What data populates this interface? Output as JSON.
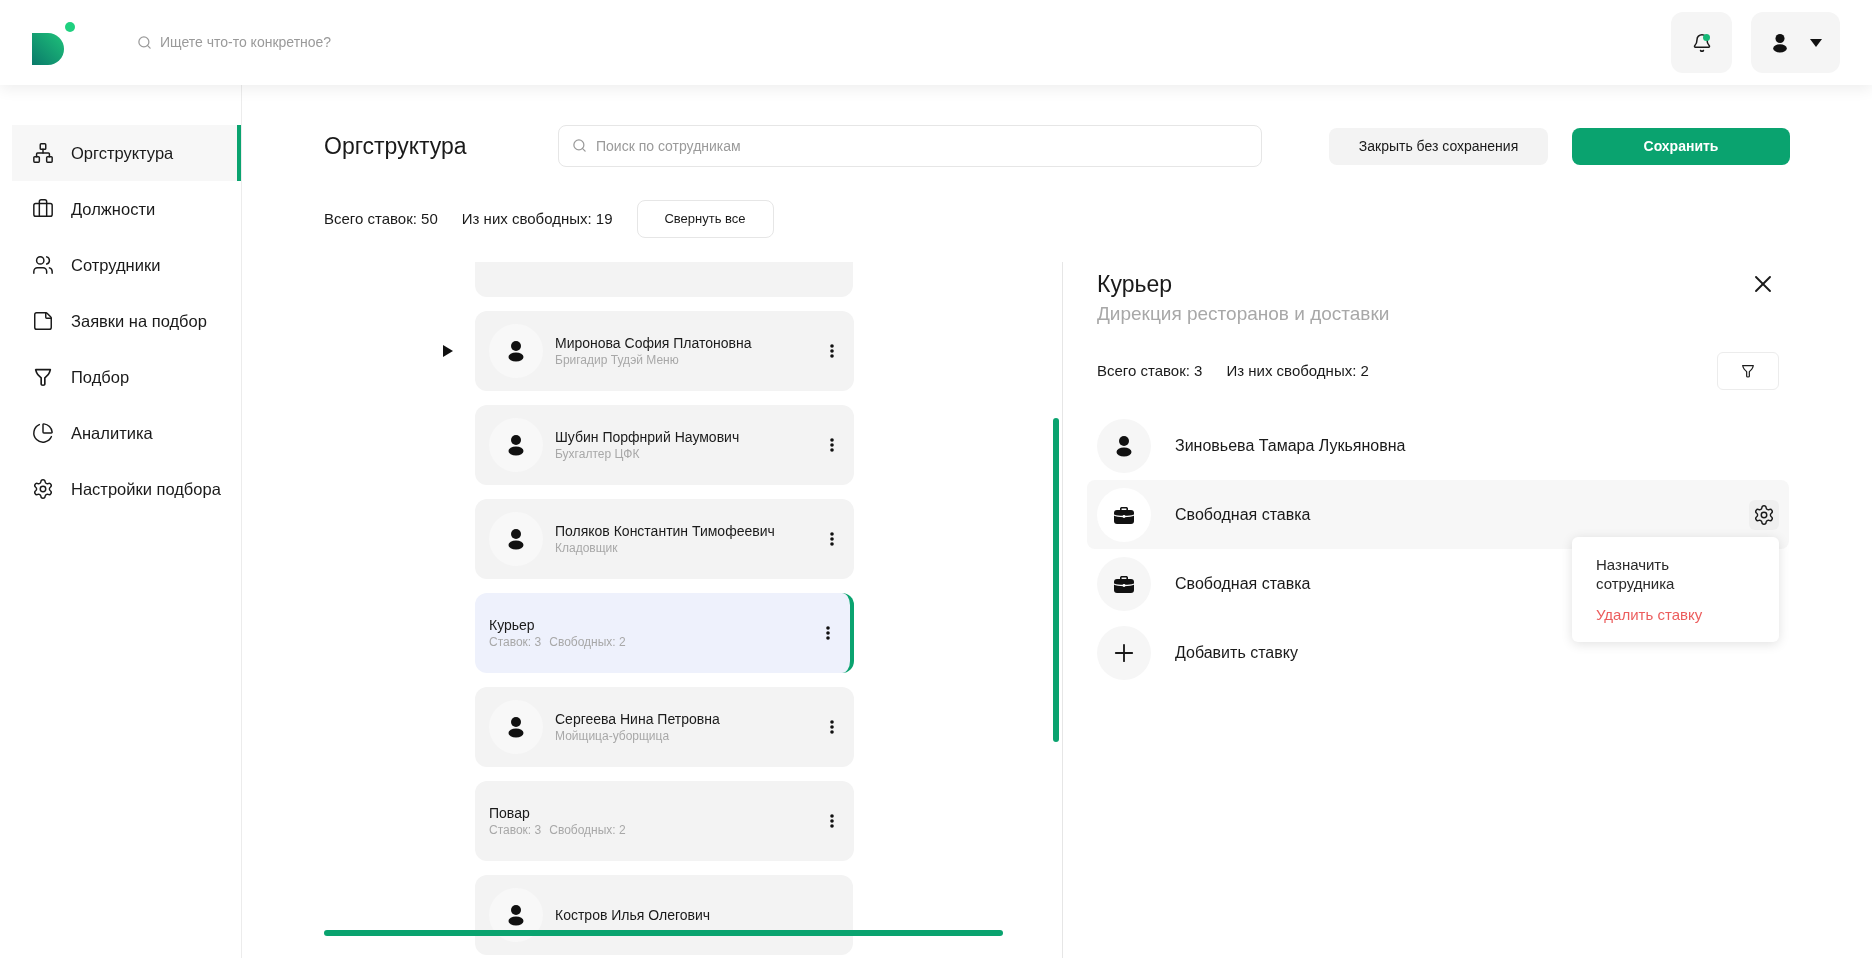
{
  "header": {
    "search_placeholder": "Ищете что-то конкретное?",
    "has_notification": true
  },
  "sidebar": {
    "items": [
      {
        "label": "Оргструктура",
        "selected": true
      },
      {
        "label": "Должности",
        "selected": false
      },
      {
        "label": "Сотрудники",
        "selected": false
      },
      {
        "label": "Заявки на подбор",
        "selected": false
      },
      {
        "label": "Подбор",
        "selected": false
      },
      {
        "label": "Аналитика",
        "selected": false
      },
      {
        "label": "Настройки подбора",
        "selected": false
      }
    ]
  },
  "page": {
    "title": "Оргструктура",
    "search_placeholder": "Поиск по сотрудникам",
    "buttons": [
      {
        "label": "Закрыть без сохранения",
        "kind": "secondary"
      },
      {
        "label": "Сохранить",
        "kind": "primary"
      }
    ],
    "stats": [
      "Всего ставок: 50",
      "Из них свободных: 19"
    ],
    "collapse_button": "Свернуть все"
  },
  "tree": {
    "children": [
      {
        "kind": "employee",
        "name": "Миронова София Платоновна",
        "role": "Бригадир Тудэй Меню",
        "expanded": false,
        "selected": false
      },
      {
        "kind": "employee",
        "name": "Шубин Порфнрий Наумович",
        "role": "Бухгалтер ЦФК",
        "selected": false
      },
      {
        "kind": "employee",
        "name": "Поляков Константин Тимофеевич",
        "role": "Кладовщик",
        "selected": false
      },
      {
        "kind": "position",
        "title": "Курьер",
        "stats": [
          "Ставок: 3",
          "Свободных: 2"
        ],
        "selected": true
      },
      {
        "kind": "employee",
        "name": "Сергеева Нина Петровна",
        "role": "Мойщица-уборщица",
        "selected": false
      },
      {
        "kind": "position",
        "title": "Повар",
        "stats": [
          "Ставок: 3",
          "Свободных: 2"
        ],
        "selected": false
      }
    ],
    "next_node": {
      "name": "Костров Илья Олегович"
    }
  },
  "detail": {
    "title": "Курьер",
    "subtitle": "Дирекция ресторанов и доставки",
    "stats": [
      "Всего ставок: 3",
      "Из них свободных: 2"
    ],
    "rows": [
      {
        "kind": "employee",
        "label": "Зиновьева Тамара Лукьяновна",
        "hovered": false
      },
      {
        "kind": "vacancy",
        "label": "Свободная ставка",
        "hovered": true
      },
      {
        "kind": "vacancy",
        "label": "Свободная ставка",
        "hovered": false
      },
      {
        "kind": "add",
        "label": "Добавить ставку",
        "hovered": false
      }
    ],
    "menu": {
      "items": [
        {
          "label": "Назначить сотрудника",
          "kind": "normal"
        },
        {
          "label": "Удалить ставку",
          "kind": "danger"
        }
      ]
    }
  }
}
